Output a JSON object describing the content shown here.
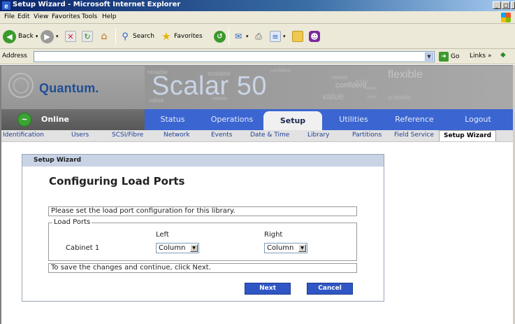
{
  "window": {
    "title": "Setup Wizard - Microsoft Internet Explorer"
  },
  "menu": [
    "File",
    "Edit",
    "View",
    "Favorites",
    "Tools",
    "Help"
  ],
  "toolbar": {
    "back_label": "Back",
    "search_label": "Search",
    "favorites_label": "Favorites"
  },
  "address": {
    "label": "Address",
    "value": "",
    "go_label": "Go",
    "links_label": "Links »"
  },
  "header": {
    "logo_text": "Quantum.",
    "product_name": "Scalar 50",
    "watermarks": [
      "reliable",
      "scalable",
      "confident",
      "flexible",
      "value",
      "reliable",
      "confident",
      "flexible",
      "value",
      "flexible",
      "scalable",
      "reliable",
      "value"
    ]
  },
  "status": {
    "label": "Online",
    "color": "#3ca334"
  },
  "nav": {
    "items": [
      "Status",
      "Operations",
      "Setup",
      "Utilities",
      "Reference",
      "Logout"
    ],
    "active": "Setup",
    "color": "#3b65d1"
  },
  "subnav": {
    "items": [
      "Identification",
      "Users",
      "SCSI/Fibre",
      "Network",
      "Events",
      "Date & Time",
      "Library",
      "Partitions",
      "Field Service",
      "Setup Wizard"
    ],
    "active": "Setup Wizard"
  },
  "wizard": {
    "header": "Setup Wizard",
    "title": "Configuring Load Ports",
    "instruction": "Please set the load port configuration for this library.",
    "legend": "Load Ports",
    "columns": [
      "Left",
      "Right"
    ],
    "rows": [
      {
        "label": "Cabinet 1",
        "left": "Column",
        "right": "Column"
      }
    ],
    "footer": "To save the changes and continue, click Next.",
    "next_label": "Next",
    "cancel_label": "Cancel"
  }
}
